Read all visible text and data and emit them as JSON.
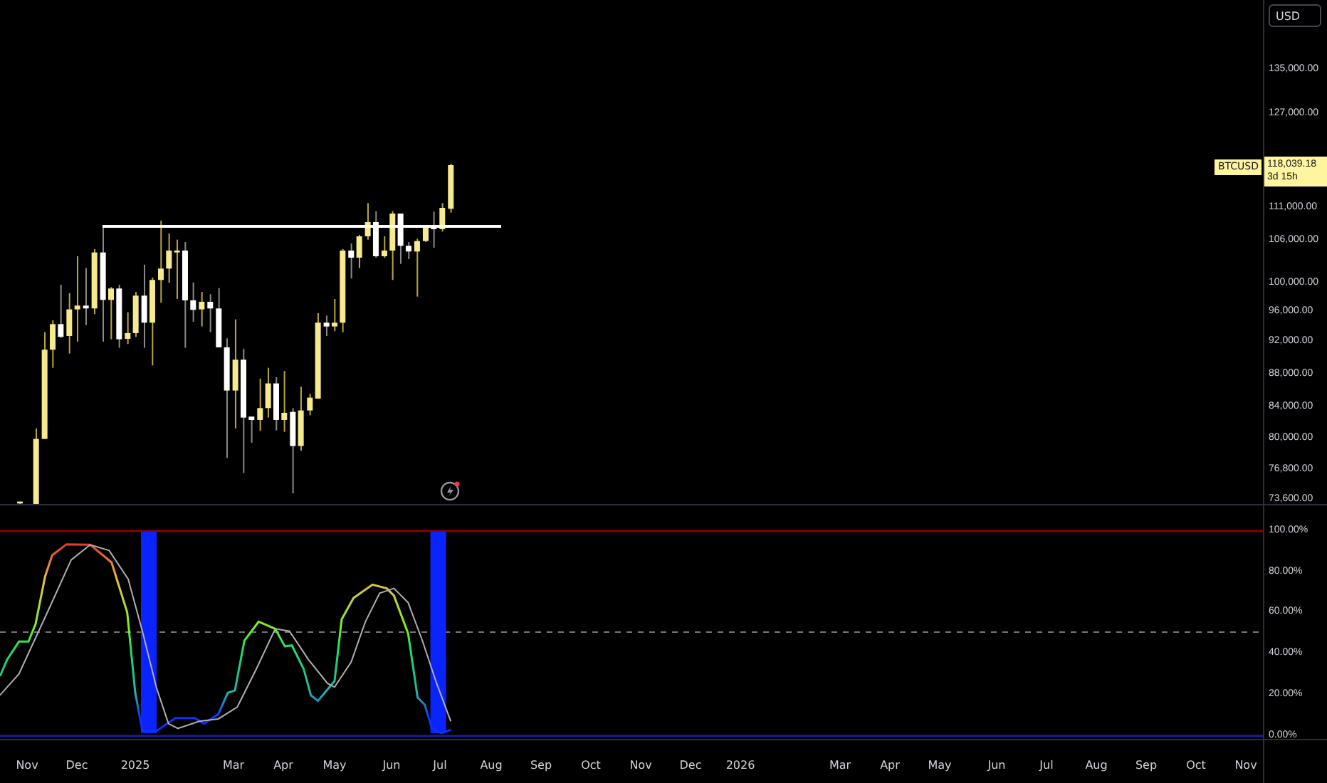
{
  "price_axis": {
    "currency": "USD",
    "ticks": [
      "135,000.00",
      "127,000.00",
      "111,000.00",
      "106,000.00",
      "100,000.00",
      "96,000.00",
      "92,000.00",
      "88,000.00",
      "84,000.00",
      "80,000.00",
      "76,800.00",
      "73,600.00"
    ],
    "symbol_label": "BTCUSD",
    "last_price": "118,039.18",
    "countdown": "3d 15h"
  },
  "indicator_axis": {
    "ticks": [
      "100.00%",
      "80.00%",
      "60.00%",
      "40.00%",
      "20.00%",
      "0.00%"
    ]
  },
  "time_axis": {
    "labels": [
      "Nov",
      "Dec",
      "2025",
      "Mar",
      "Apr",
      "May",
      "Jun",
      "Jul",
      "Aug",
      "Sep",
      "Oct",
      "Nov",
      "Dec",
      "2026",
      "Mar",
      "Apr",
      "May",
      "Jun",
      "Jul",
      "Aug",
      "Sep",
      "Oct",
      "Nov"
    ]
  }
}
